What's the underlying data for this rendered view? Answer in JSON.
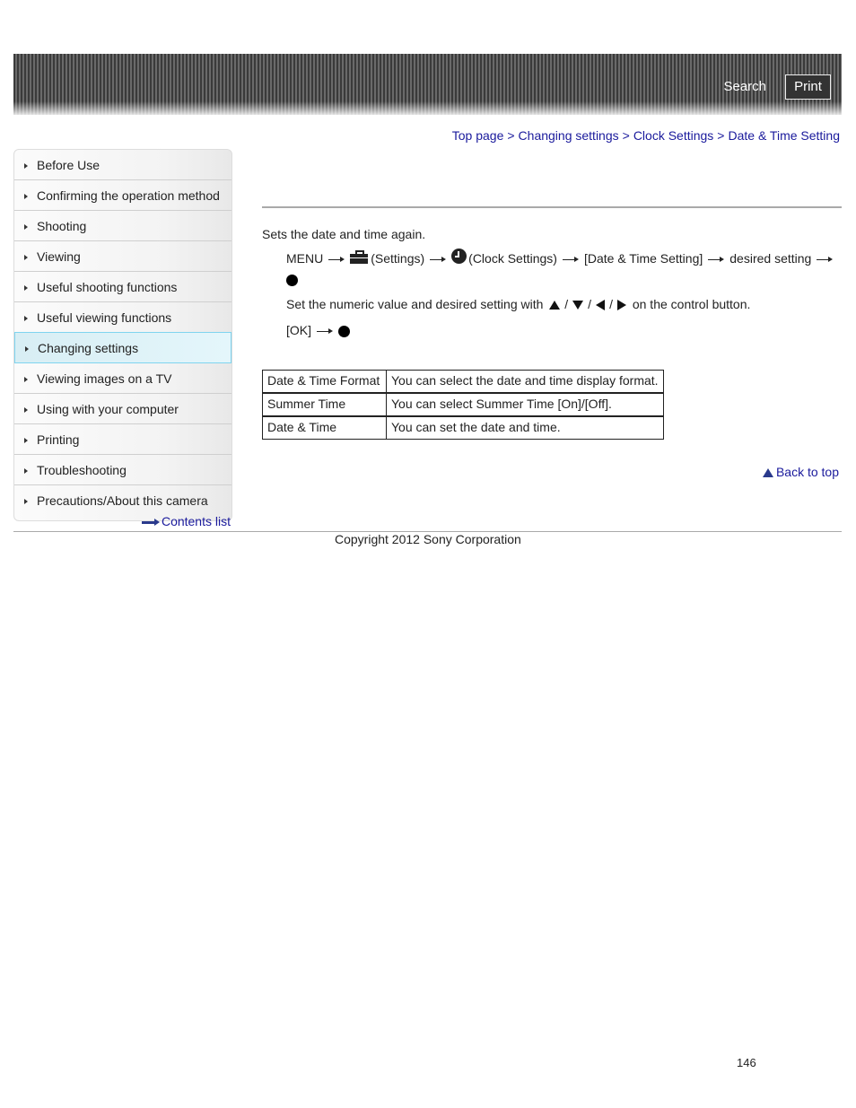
{
  "header": {
    "search_label": "Search",
    "print_label": "Print"
  },
  "breadcrumb": [
    {
      "label": "Top page"
    },
    {
      "label": "Changing settings"
    },
    {
      "label": "Clock Settings"
    },
    {
      "label": "Date & Time Setting"
    }
  ],
  "breadcrumb_separator": ">",
  "sidebar": {
    "items": [
      {
        "label": "Before Use",
        "active": false
      },
      {
        "label": "Confirming the operation method",
        "active": false
      },
      {
        "label": "Shooting",
        "active": false
      },
      {
        "label": "Viewing",
        "active": false
      },
      {
        "label": "Useful shooting functions",
        "active": false
      },
      {
        "label": "Useful viewing functions",
        "active": false
      },
      {
        "label": "Changing settings",
        "active": true
      },
      {
        "label": "Viewing images on a TV",
        "active": false
      },
      {
        "label": "Using with your computer",
        "active": false
      },
      {
        "label": "Printing",
        "active": false
      },
      {
        "label": "Troubleshooting",
        "active": false
      },
      {
        "label": "Precautions/About this camera",
        "active": false
      }
    ],
    "contents_list_label": "Contents list"
  },
  "main": {
    "intro": "Sets the date and time again.",
    "step1": {
      "menu": "MENU",
      "settings_icon": "toolbox-icon",
      "settings_label": "(Settings)",
      "clock_icon": "clock-icon",
      "clock_label": "(Clock Settings)",
      "item_label": "[Date & Time Setting]",
      "desired_label": "desired setting",
      "confirm_icon": "center-button-dot"
    },
    "step2": {
      "prefix": "Set the numeric value and desired setting with",
      "direction_icons": [
        "up-triangle",
        "down-triangle",
        "left-triangle",
        "right-triangle"
      ],
      "separator": "/",
      "suffix": "on the control button."
    },
    "step3": {
      "ok_label": "[OK]",
      "confirm_icon": "center-button-dot"
    },
    "table": [
      {
        "item": "Date & Time Format",
        "description": "You can select the date and time display format."
      },
      {
        "item": "Summer Time",
        "description": "You can select Summer Time [On]/[Off]."
      },
      {
        "item": "Date & Time",
        "description": "You can set the date and time."
      }
    ],
    "back_to_top_label": "Back to top"
  },
  "footer": {
    "copyright": "Copyright 2012 Sony Corporation",
    "page_number": "146"
  }
}
